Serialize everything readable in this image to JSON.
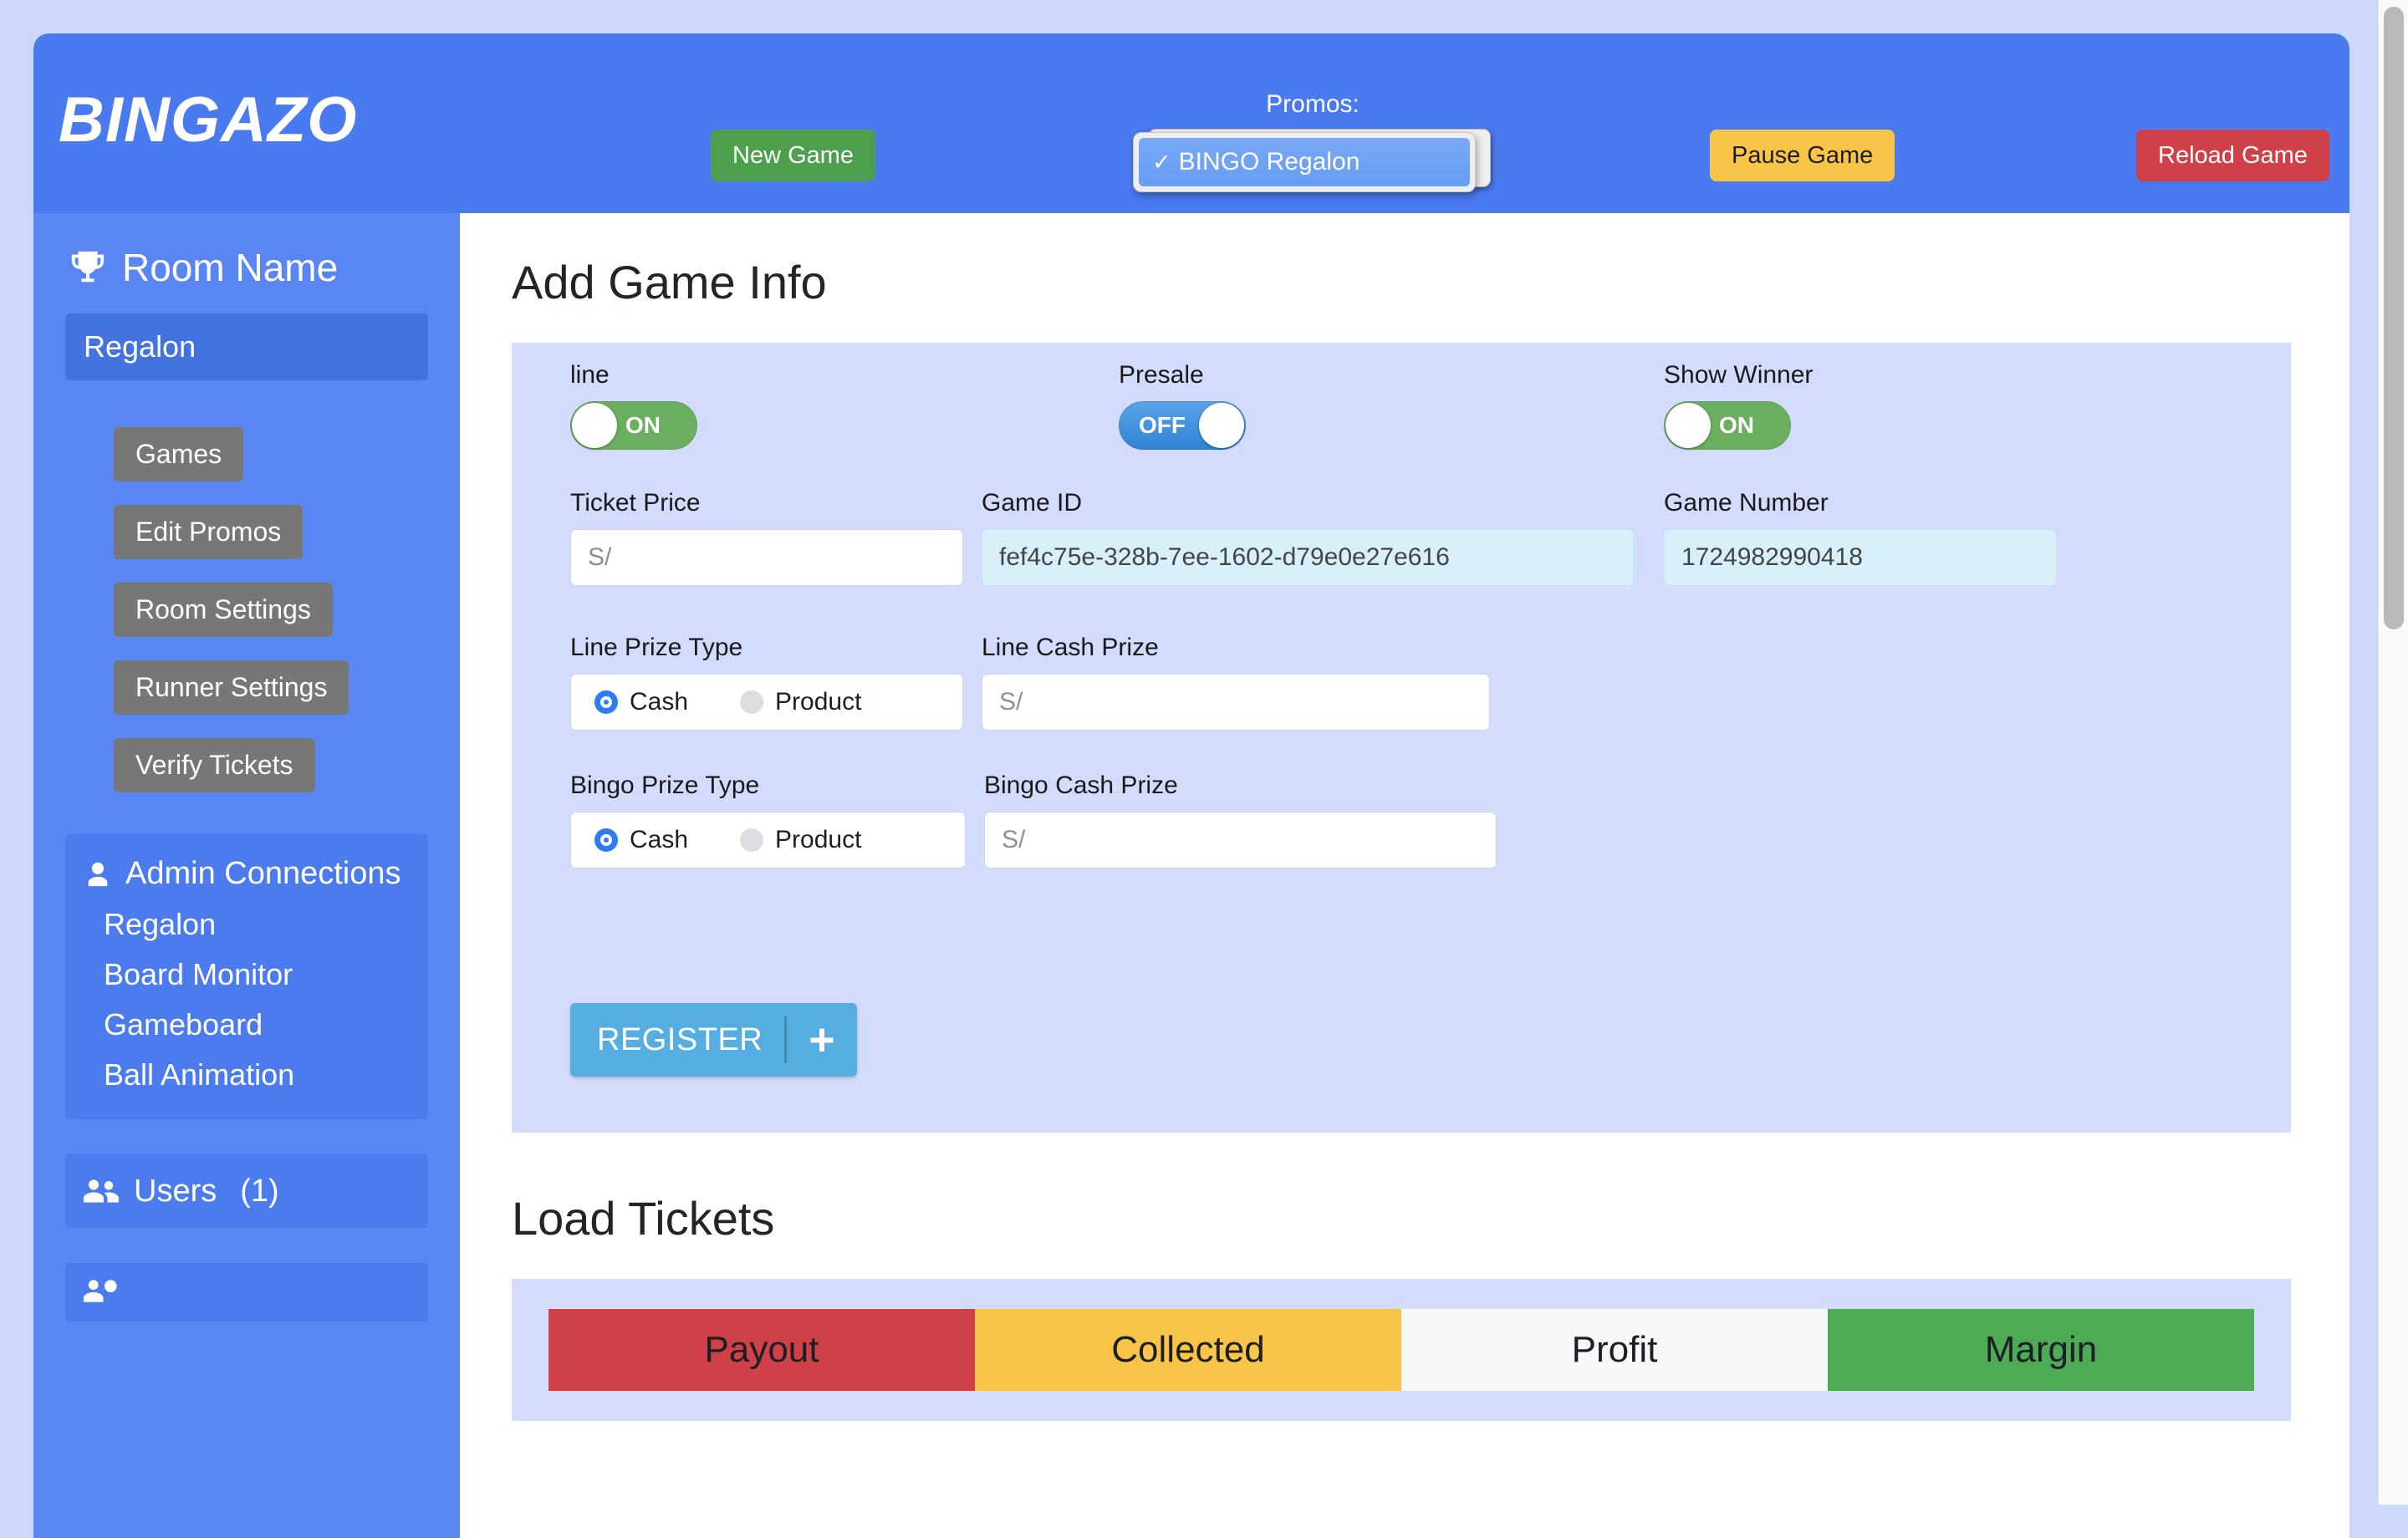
{
  "header": {
    "brand": "BINGAZO",
    "new_game_label": "New Game",
    "pause_game_label": "Pause Game",
    "reload_game_label": "Reload Game",
    "promos_label": "Promos:",
    "promos_selected": "BINGO Regalon",
    "promos_check_glyph": "✓",
    "promos_caret_glyph": "⌄"
  },
  "sidebar": {
    "trophy_icon": "trophy-icon",
    "room_name_title": "Room Name",
    "room_selected": "Regalon",
    "nav_buttons": [
      {
        "label": "Games"
      },
      {
        "label": "Edit Promos"
      },
      {
        "label": "Room Settings"
      },
      {
        "label": "Runner Settings"
      },
      {
        "label": "Verify Tickets"
      }
    ],
    "admin_connections": {
      "title": "Admin Connections",
      "icon": "user-icon",
      "items": [
        {
          "label": "Regalon"
        },
        {
          "label": "Board Monitor"
        },
        {
          "label": "Gameboard"
        },
        {
          "label": "Ball Animation"
        }
      ]
    },
    "users": {
      "title": "Users",
      "count": "(1)",
      "icon": "users-icon"
    },
    "bottom_panel": {
      "icon": "users-gear-icon"
    }
  },
  "main": {
    "add_game_info_title": "Add Game Info",
    "toggles": [
      {
        "label": "line",
        "state": "ON",
        "on": true
      },
      {
        "label": "Presale",
        "state": "OFF",
        "on": false
      },
      {
        "label": "Show Winner",
        "state": "ON",
        "on": true
      }
    ],
    "fields": {
      "ticket_price": {
        "label": "Ticket Price",
        "value": "",
        "placeholder": "S/"
      },
      "game_id": {
        "label": "Game ID",
        "value": "fef4c75e-328b-7ee-1602-d79e0e27e616",
        "placeholder": ""
      },
      "game_number": {
        "label": "Game Number",
        "value": "1724982990418",
        "placeholder": ""
      },
      "line_cash_prize": {
        "label": "Line Cash Prize",
        "value": "",
        "placeholder": "S/"
      },
      "bingo_cash_prize": {
        "label": "Bingo Cash Prize",
        "value": "",
        "placeholder": "S/"
      }
    },
    "prize_types": [
      {
        "label": "Line Prize Type",
        "options": [
          {
            "label": "Cash",
            "checked": true
          },
          {
            "label": "Product",
            "checked": false
          }
        ]
      },
      {
        "label": "Bingo Prize Type",
        "options": [
          {
            "label": "Cash",
            "checked": true
          },
          {
            "label": "Product",
            "checked": false
          }
        ]
      }
    ],
    "register": {
      "label": "REGISTER",
      "plus_glyph": "+"
    },
    "load_tickets_title": "Load Tickets",
    "metrics": [
      {
        "label": "Payout",
        "color": "#cf4048"
      },
      {
        "label": "Collected",
        "color": "#f8c549"
      },
      {
        "label": "Profit",
        "color": "#f7f8fa"
      },
      {
        "label": "Margin",
        "color": "#4daa55"
      }
    ]
  },
  "colors": {
    "header_blue": "#4a7af0",
    "sidebar_blue": "#5a86f4",
    "panel_lavender": "#d3dcfc",
    "page_bg": "#ccd9fb",
    "accent_register": "#55ade0"
  }
}
